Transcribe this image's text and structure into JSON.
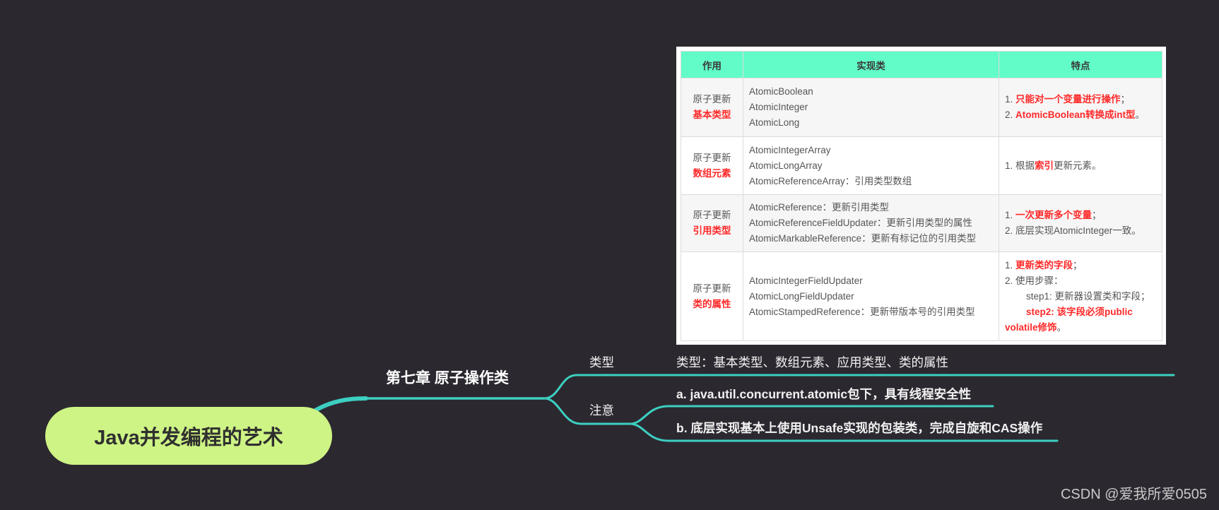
{
  "colors": {
    "bg": "#2c2830",
    "accent": "#3ccfc0",
    "root_fill": "#cef485",
    "root_text": "#2f2f2f",
    "node_text": "#f2f2f2",
    "header_bg": "#61fcc8",
    "highlight": "#ff2a2a",
    "table_border": "#dcdcdc",
    "row_alt": "#f6f6f6",
    "table_text": "#555555",
    "watermark": "#c9c9c9"
  },
  "root": {
    "label": "Java并发编程的艺术"
  },
  "chapter": {
    "label": "第七章 原子操作类"
  },
  "type_branch": {
    "label": "类型",
    "content": "类型：基本类型、数组元素、应用类型、类的属性"
  },
  "note_branch": {
    "label": "注意",
    "items": [
      "a. java.util.concurrent.atomic包下，具有线程安全性",
      "b. 底层实现基本上使用Unsafe实现的包装类，完成自旋和CAS操作"
    ]
  },
  "table": {
    "headers": [
      "作用",
      "实现类",
      "特点"
    ],
    "rows": [
      {
        "purpose": {
          "line1": "原子更新",
          "line2": "基本类型"
        },
        "classes": [
          "AtomicBoolean",
          "AtomicInteger",
          "AtomicLong"
        ],
        "features": [
          {
            "prefix": "1. ",
            "highlight": "只能对一个变量进行操作",
            "suffix": "；"
          },
          {
            "prefix": "2. ",
            "highlight": "AtomicBoolean转换成int型",
            "suffix": "。"
          }
        ]
      },
      {
        "purpose": {
          "line1": "原子更新",
          "line2": "数组元素"
        },
        "classes": [
          "AtomicIntegerArray",
          "AtomicLongArray",
          "AtomicReferenceArray：引用类型数组"
        ],
        "features": [
          {
            "prefix": "1. 根据",
            "highlight": "索引",
            "suffix": "更新元素。"
          }
        ]
      },
      {
        "purpose": {
          "line1": "原子更新",
          "line2": "引用类型"
        },
        "classes": [
          "AtomicReference：更新引用类型",
          "AtomicReferenceFieldUpdater：更新引用类型的属性",
          "AtomicMarkableReference：更新有标记位的引用类型"
        ],
        "features": [
          {
            "prefix": "1. ",
            "highlight": "一次更新多个变量",
            "suffix": "；"
          },
          {
            "prefix": "2. 底层实现AtomicInteger一致。"
          }
        ]
      },
      {
        "purpose": {
          "line1": "原子更新",
          "line2": "类的属性"
        },
        "classes": [
          "AtomicIntegerFieldUpdater",
          "AtomicLongFieldUpdater",
          "AtomicStampedReference：更新带版本号的引用类型"
        ],
        "features": [
          {
            "prefix": "1. ",
            "highlight": "更新类的字段",
            "suffix": "；"
          },
          {
            "prefix": "2. 使用步骤："
          },
          {
            "prefix": "step1: 更新器设置类和字段；"
          },
          {
            "highlight": "step2: 该字段必须public volatile修饰",
            "suffix": "。"
          }
        ]
      }
    ]
  },
  "watermark": "CSDN @爱我所爱0505"
}
